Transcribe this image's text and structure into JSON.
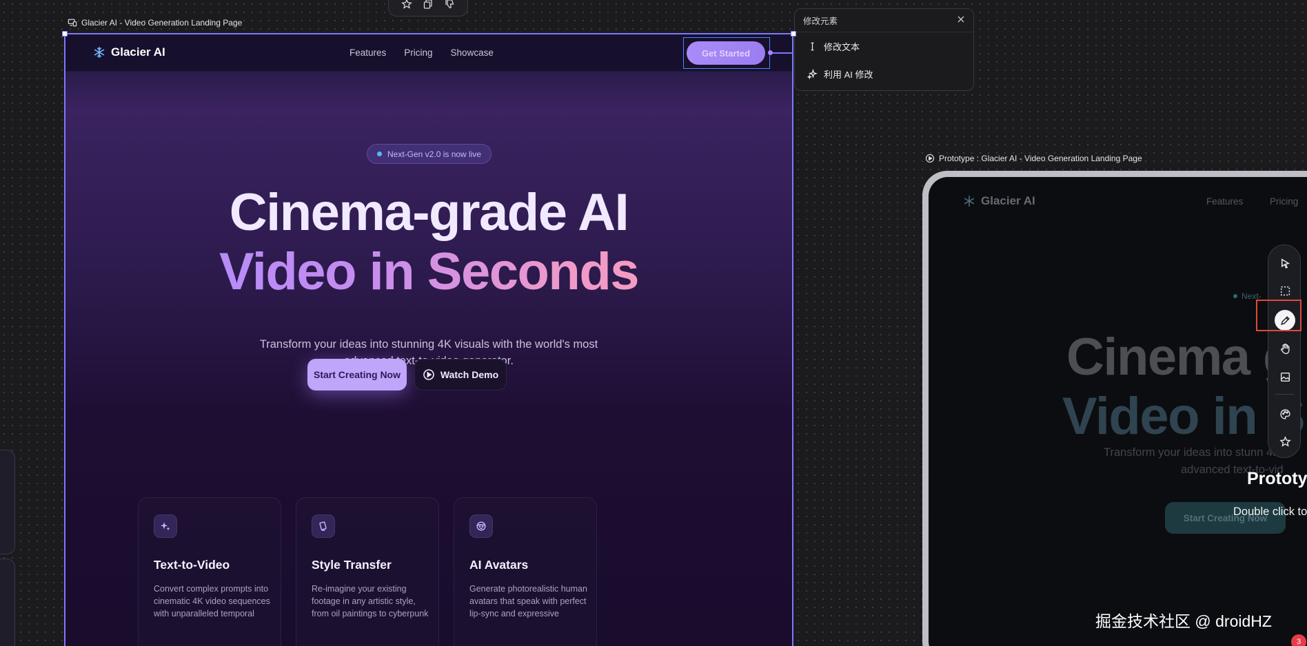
{
  "canvas": {
    "main_frame_label": "Glacier AI - Video Generation Landing Page",
    "prototype_frame_label": "Prototype : Glacier AI - Video Generation Landing Page",
    "top_toolbar_icons": [
      "star-icon",
      "copy-icon",
      "thumbs-down-icon"
    ]
  },
  "landing": {
    "brand": "Glacier AI",
    "nav_links": [
      "Features",
      "Pricing",
      "Showcase"
    ],
    "cta": "Get Started",
    "badge": "Next-Gen v2.0 is now live",
    "title_line1": "Cinema-grade AI",
    "title_line2": "Video in Seconds",
    "subtitle_line1": "Transform your ideas into stunning 4K visuals with the world's most",
    "subtitle_line2": "advanced text-to-video generator.",
    "primary_button": "Start Creating Now",
    "secondary_button": "Watch Demo",
    "features": [
      {
        "icon": "sparkles-icon",
        "title": "Text-to-Video",
        "desc": [
          "Convert complex prompts into",
          "cinematic 4K video sequences",
          "with unparalleled temporal"
        ]
      },
      {
        "icon": "brush-icon",
        "title": "Style Transfer",
        "desc": [
          "Re-imagine your existing",
          "footage in any artistic style,",
          "from oil paintings to cyberpunk"
        ]
      },
      {
        "icon": "face-icon",
        "title": "AI Avatars",
        "desc": [
          "Generate photorealistic human",
          "avatars that speak with perfect",
          "lip-sync and expressive"
        ]
      }
    ]
  },
  "edit_popup": {
    "title": "修改元素",
    "items": [
      "修改文本",
      "利用 AI 修改"
    ]
  },
  "prototype": {
    "brand": "Glacier AI",
    "nav_links": [
      "Features",
      "Pricing"
    ],
    "badge": "Next-",
    "title_line1": "Cinema g",
    "title_line2": "Video in S",
    "subtitle_line1": "Transform your ideas into stunn 4K",
    "subtitle_line2": "advanced text-to-vid",
    "button": "Start Creating Now",
    "overlay_title": "Prototy",
    "overlay_sub": "Double click to",
    "tools": [
      "cursor-icon",
      "marquee-select-icon",
      "pencil-icon",
      "hand-icon",
      "image-icon",
      "palette-icon",
      "star-icon"
    ],
    "active_tool": "pencil-icon"
  },
  "watermark": "掘金技术社区 @ droidHZ",
  "notification_count": "3"
}
